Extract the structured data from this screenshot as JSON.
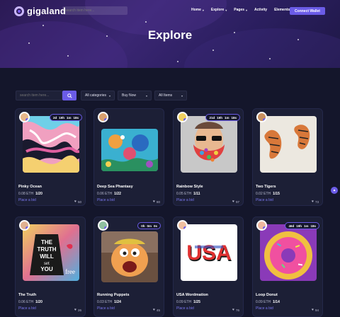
{
  "header": {
    "logo_text": "gigaland",
    "search_placeholder": "search item here...",
    "menu": [
      {
        "label": "Home",
        "caret": true
      },
      {
        "label": "Explore",
        "caret": true
      },
      {
        "label": "Pages",
        "caret": true
      },
      {
        "label": "Activity",
        "caret": false
      },
      {
        "label": "Elements",
        "caret": true
      }
    ],
    "connect_label": "Connect Wallet"
  },
  "page_title": "Explore",
  "filters": {
    "search_placeholder": "search item here...",
    "category": "All categories",
    "type": "Buy Now",
    "items": "All Items"
  },
  "cards": [
    {
      "title": "Pinky Ocean",
      "price": "0.08 ETH",
      "count": "1/20",
      "bid": "Place a bid",
      "likes": "50",
      "timer": [
        "2d",
        "19h",
        "1m",
        "18s"
      ]
    },
    {
      "title": "Deep Sea Phantasy",
      "price": "0.06 ETH",
      "count": "1/22",
      "bid": "Place a bid",
      "likes": "80",
      "timer": []
    },
    {
      "title": "Rainbow Style",
      "price": "0.05 ETH",
      "count": "1/11",
      "bid": "Place a bid",
      "likes": "97",
      "timer": [
        "21d",
        "19h",
        "1m",
        "18s"
      ]
    },
    {
      "title": "Two Tigers",
      "price": "0.02 ETH",
      "count": "1/15",
      "bid": "Place a bid",
      "likes": "73",
      "timer": []
    },
    {
      "title": "The Truth",
      "price": "0.06 ETH",
      "count": "1/20",
      "bid": "Place a bid",
      "likes": "26",
      "timer": []
    },
    {
      "title": "Running Puppets",
      "price": "0.03 ETH",
      "count": "1/24",
      "bid": "Place a bid",
      "likes": "45",
      "timer": [
        "0h",
        "0m",
        "0s"
      ]
    },
    {
      "title": "USA Wordmation",
      "price": "0.09 ETH",
      "count": "1/25",
      "bid": "Place a bid",
      "likes": "76",
      "timer": []
    },
    {
      "title": "Loop Donut",
      "price": "0.09 ETH",
      "count": "1/14",
      "bid": "Place a bid",
      "likes": "94",
      "timer": [
        "46d",
        "19h",
        "1m",
        "18s"
      ]
    }
  ],
  "art_text": {
    "truth": [
      "THE",
      "TRUTH",
      "WILL",
      "set",
      "YOU",
      "free"
    ],
    "usa": "USA"
  },
  "colors": {
    "accent": "#6b5ce7",
    "background": "#14162b",
    "card": "#1c1f36",
    "link": "#7b78f0"
  }
}
